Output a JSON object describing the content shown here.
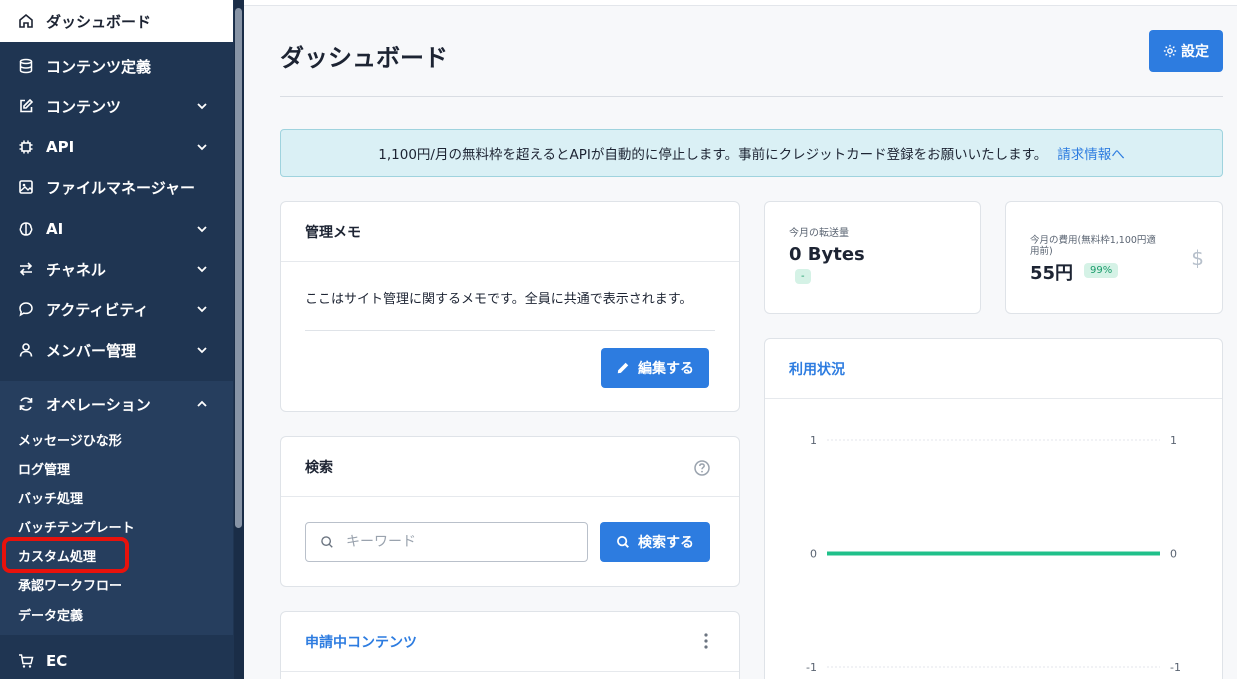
{
  "sidebar": {
    "active": {
      "label": "ダッシュボード"
    },
    "items": [
      {
        "label": "コンテンツ定義"
      },
      {
        "label": "コンテンツ"
      },
      {
        "label": "API"
      },
      {
        "label": "ファイルマネージャー"
      },
      {
        "label": "AI"
      },
      {
        "label": "チャネル"
      },
      {
        "label": "アクティビティ"
      },
      {
        "label": "メンバー管理"
      },
      {
        "label": "オペレーション"
      }
    ],
    "sub_items": [
      {
        "label": "メッセージひな形"
      },
      {
        "label": "ログ管理"
      },
      {
        "label": "バッチ処理"
      },
      {
        "label": "バッチテンプレート"
      },
      {
        "label": "カスタム処理"
      },
      {
        "label": "承認ワークフロー"
      },
      {
        "label": "データ定義"
      }
    ],
    "ec": {
      "label": "EC"
    }
  },
  "header": {
    "title": "ダッシュボード",
    "settings_label": "設定"
  },
  "notice": {
    "text": "1,100円/月の無料枠を超えるとAPIが自動的に停止します。事前にクレジットカード登録をお願いいたします。",
    "link": "請求情報へ"
  },
  "memo": {
    "title": "管理メモ",
    "text": "ここはサイト管理に関するメモです。全員に共通で表示されます。",
    "edit_label": "編集する"
  },
  "search": {
    "title": "検索",
    "placeholder": "キーワード",
    "button_label": "検索する"
  },
  "pending": {
    "title": "申請中コンテンツ"
  },
  "transfer": {
    "label": "今月の転送量",
    "value": "0 Bytes",
    "badge": "-"
  },
  "cost": {
    "label_line1": "今月の費用(無料枠1,100円適",
    "label_line2": "用前)",
    "value": "55円",
    "badge": "99%",
    "icon": "$"
  },
  "usage": {
    "title": "利用状況"
  },
  "colors": {
    "accent": "#2d7ce0",
    "sidebar": "#1f3552",
    "line": "#20c08a",
    "highlight": "#e8120c"
  },
  "chart_data": {
    "type": "line",
    "title": "利用状況",
    "y_ticks_left": [
      "1",
      "0",
      "-1"
    ],
    "y_ticks_right": [
      "1",
      "0",
      "-1"
    ],
    "ylim": [
      -1,
      1
    ],
    "series": [
      {
        "values": [
          0,
          0
        ]
      }
    ]
  }
}
